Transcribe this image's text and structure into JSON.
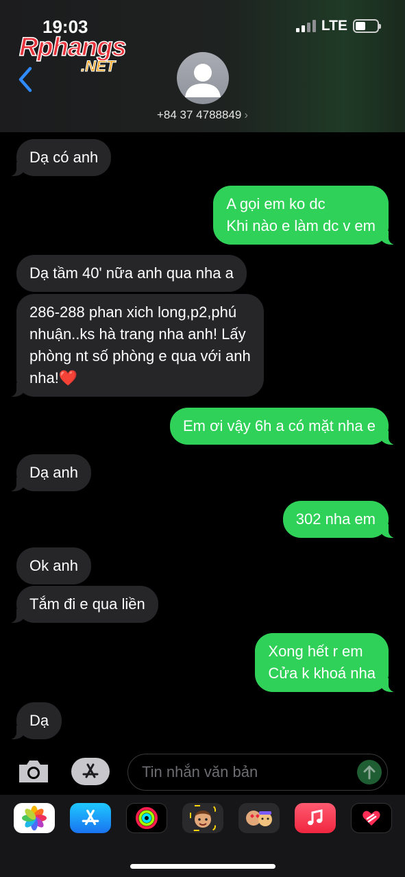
{
  "status_bar": {
    "time": "19:03",
    "network": "LTE"
  },
  "watermark": {
    "brand": "Rphangs",
    "suffix": ".NET"
  },
  "header": {
    "contact": "+84 37 4788849",
    "chevron": "›"
  },
  "messages": [
    {
      "dir": "in",
      "text": "Dạ có anh"
    },
    {
      "dir": "out",
      "text": "A gọi em ko dc\nKhi nào e làm dc v em"
    },
    {
      "dir": "in",
      "text": "Dạ tầm 40' nữa anh qua nha a"
    },
    {
      "dir": "in",
      "text": "286-288 phan xich long,p2,phú\nnhuận..ks hà trang nha anh! Lấy\nphòng nt số phòng e qua với anh\nnha!❤️"
    },
    {
      "dir": "out",
      "text": "Em ơi vậy 6h a có mặt nha e"
    },
    {
      "dir": "in",
      "text": "Dạ anh"
    },
    {
      "dir": "out",
      "text": "302 nha em"
    },
    {
      "dir": "in",
      "text": "Ok anh"
    },
    {
      "dir": "in",
      "text": "Tắm đi e qua liền"
    },
    {
      "dir": "out",
      "text": "Xong hết r em\nCửa k khoá nha"
    },
    {
      "dir": "in",
      "text": "Dạ"
    }
  ],
  "composer": {
    "placeholder": "Tin nhắn văn bản"
  },
  "app_drawer": [
    "photos-app",
    "app-store-app",
    "activity-app",
    "memoji-app",
    "memoji-stickers-app",
    "music-app",
    "digital-touch-app"
  ],
  "colors": {
    "outgoing": "#30d158",
    "incoming": "#262629",
    "background": "#000000"
  }
}
